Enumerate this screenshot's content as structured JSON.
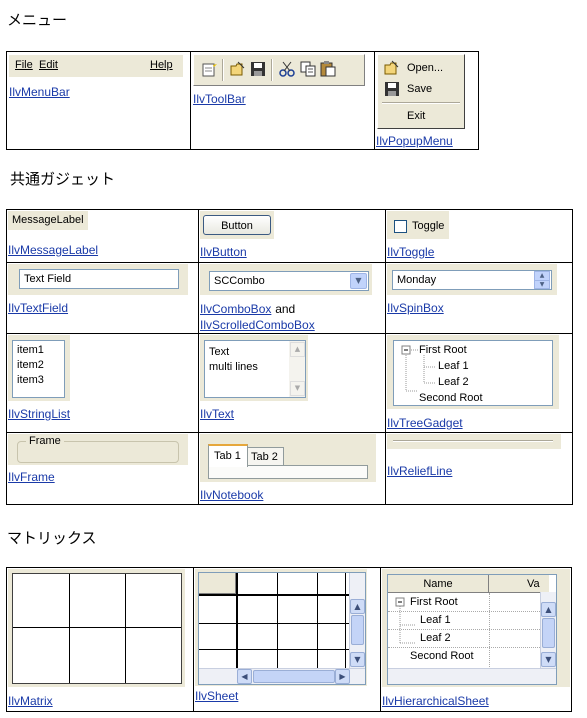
{
  "sections": {
    "menu_title": "メニュー",
    "common_title": "共通ガジェット",
    "matrix_title": "マトリックス"
  },
  "menu": {
    "menubar": {
      "file": "File",
      "edit": "Edit",
      "help": "Help",
      "link": "IlvMenuBar"
    },
    "toolbar": {
      "link": "IlvToolBar",
      "icons": [
        "new-document-icon",
        "open-folder-icon",
        "save-disk-icon",
        "cut-scissors-icon",
        "copy-icon",
        "paste-icon"
      ]
    },
    "popup": {
      "open": "Open...",
      "save": "Save",
      "exit": "Exit",
      "link": "IlvPopupMenu"
    }
  },
  "gadgets": {
    "message_label": {
      "text": "MessageLabel",
      "link": "IlvMessageLabel"
    },
    "button": {
      "text": "Button",
      "link": "IlvButton"
    },
    "toggle": {
      "text": "Toggle",
      "link": "IlvToggle"
    },
    "text_field": {
      "value": "Text Field",
      "link": "IlvTextField"
    },
    "combo": {
      "value": "SCCombo",
      "link1": "IlvComboBox",
      "and": "and",
      "link2": "IlvScrolledComboBox"
    },
    "spin": {
      "value": "Monday",
      "link": "IlvSpinBox"
    },
    "string_list": {
      "items": [
        "item1",
        "item2",
        "item3"
      ],
      "link": "IlvStringList"
    },
    "text": {
      "line1": "Text",
      "line2": "multi lines",
      "link": "IlvText"
    },
    "tree": {
      "first_root": "First Root",
      "leaf1": "Leaf 1",
      "leaf2": "Leaf 2",
      "second_root": "Second Root",
      "link": "IlvTreeGadget"
    },
    "frame": {
      "label": "Frame",
      "link": "IlvFrame"
    },
    "notebook": {
      "tab1": "Tab 1",
      "tab2": "Tab 2",
      "link": "IlvNotebook"
    },
    "relief": {
      "link": "IlvReliefLine"
    }
  },
  "matrix": {
    "matrix_link": "IlvMatrix",
    "sheet_link": "IlvSheet",
    "hsheet": {
      "col_name": "Name",
      "col_value": "Va",
      "first_root": "First Root",
      "leaf1": "Leaf 1",
      "leaf2": "Leaf 2",
      "second_root": "Second Root",
      "link": "IlvHierarchicalSheet"
    }
  }
}
